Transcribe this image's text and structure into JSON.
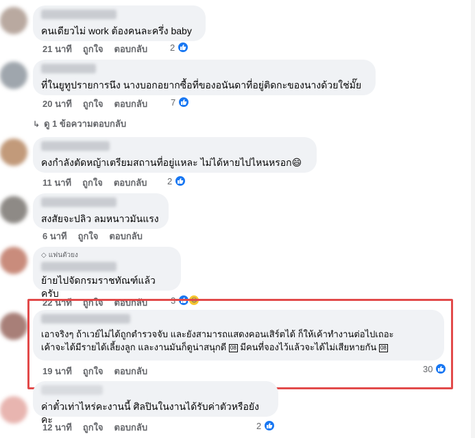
{
  "comments": [
    {
      "text": "คนเดียวไม่ work ต้องคนละครึ่ง baby",
      "time": "21 นาที",
      "like": "ถูกใจ",
      "reply": "ตอบกลับ",
      "reactions": "2"
    },
    {
      "text": "ที่ในยูทูปรายการนึง นางบอกอยากซื้อที่ของอนันดาที่อยู่ติดกะของนางด้วยใช่มั๊ย",
      "time": "20 นาที",
      "like": "ถูกใจ",
      "reply": "ตอบกลับ",
      "reactions": "7"
    },
    {
      "text": "คงกำลังตัดหญ้าเตรียมสถานที่อยู่แหละ ไม่ได้หายไปไหนหรอก😄",
      "time": "11 นาที",
      "like": "ถูกใจ",
      "reply": "ตอบกลับ",
      "reactions": "2"
    },
    {
      "text": "สงสัยจะปลิว ลมหนาวมันแรง",
      "time": "6 นาที",
      "like": "ถูกใจ",
      "reply": "ตอบกลับ",
      "reactions": ""
    },
    {
      "badge": "แฟนตัวยง",
      "text": "ย้ายไปจัดกรมราชทัณฑ์แล้วครับ",
      "time": "22 นาที",
      "like": "ถูกใจ",
      "reply": "ตอบกลับ",
      "reactions": "3"
    },
    {
      "line1": "เอาจริงๆ ถ้าเวย์ไม่ได้ถูกตำรวจจับ และยังสามารถแสดงคอนเสิร์ตได้ ก็ให้เค้าทำงานต่อไปเถอะ",
      "line2": "เค้าจะได้มีรายได้เลี้ยงลูก และงานมันก็ดูน่าสนุกดี",
      "line2b": "มีคนที่จองไว้แล้วจะได้ไม่เสียหายกัน",
      "emoji_box": "08",
      "time": "19 นาที",
      "like": "ถูกใจ",
      "reply": "ตอบกลับ",
      "reactions": "30"
    },
    {
      "text": "ค่าตั๋วเท่าไหร่คะงานนี้ ศิลปินในงานได้รับค่าตัวหรือยังคะ",
      "time": "12 นาที",
      "like": "ถูกใจ",
      "reply": "ตอบกลับ",
      "reactions": "2"
    }
  ],
  "view_replies": "ดู 1 ข้อความตอบกลับ",
  "colors": {
    "like_blue": "#1877f2",
    "bubble": "#f0f2f5",
    "highlight": "#e24a4a",
    "meta": "#65676b"
  }
}
